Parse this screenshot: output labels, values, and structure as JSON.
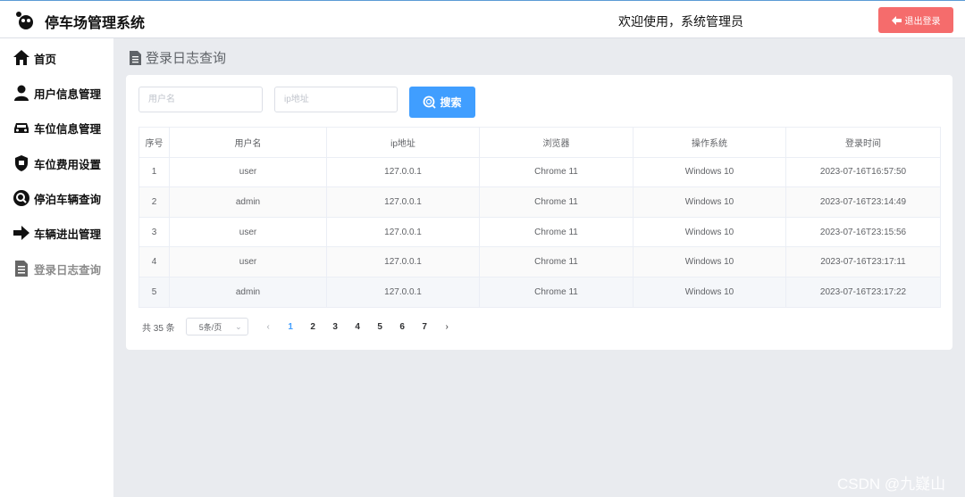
{
  "header": {
    "title": "停车场管理系统",
    "welcome": "欢迎使用，系统管理员",
    "logout_label": "退出登录",
    "border_color": "#5b9bd5"
  },
  "sidebar": {
    "items": [
      {
        "label": "首页",
        "icon": "home-icon",
        "active": false
      },
      {
        "label": "用户信息管理",
        "icon": "user-icon",
        "active": false
      },
      {
        "label": "车位信息管理",
        "icon": "car-icon",
        "active": false
      },
      {
        "label": "车位费用设置",
        "icon": "shield-icon",
        "active": false
      },
      {
        "label": "停泊车辆查询",
        "icon": "search-circle-icon",
        "active": false
      },
      {
        "label": "车辆进出管理",
        "icon": "arrow-right-icon",
        "active": false
      },
      {
        "label": "登录日志查询",
        "icon": "document-icon",
        "active": true
      }
    ]
  },
  "main": {
    "page_title": "登录日志查询",
    "filters": {
      "username_placeholder": "用户名",
      "ip_placeholder": "ip地址",
      "search_label": "搜索"
    },
    "table": {
      "columns": [
        "序号",
        "用户名",
        "ip地址",
        "浏览器",
        "操作系统",
        "登录时间"
      ],
      "rows": [
        [
          "1",
          "user",
          "127.0.0.1",
          "Chrome 11",
          "Windows 10",
          "2023-07-16T16:57:50"
        ],
        [
          "2",
          "admin",
          "127.0.0.1",
          "Chrome 11",
          "Windows 10",
          "2023-07-16T23:14:49"
        ],
        [
          "3",
          "user",
          "127.0.0.1",
          "Chrome 11",
          "Windows 10",
          "2023-07-16T23:15:56"
        ],
        [
          "4",
          "user",
          "127.0.0.1",
          "Chrome 11",
          "Windows 10",
          "2023-07-16T23:17:11"
        ],
        [
          "5",
          "admin",
          "127.0.0.1",
          "Chrome 11",
          "Windows 10",
          "2023-07-16T23:17:22"
        ]
      ]
    },
    "pagination": {
      "total": "共 35 条",
      "page_size": "5条/页",
      "pages": [
        "1",
        "2",
        "3",
        "4",
        "5",
        "6",
        "7"
      ],
      "current_page": "1",
      "prev": "‹",
      "next": "›"
    }
  },
  "watermark": "CSDN @九嶷山",
  "colors": {
    "primary": "#409eff",
    "danger": "#f56c6c",
    "background": "#e9ebef"
  }
}
